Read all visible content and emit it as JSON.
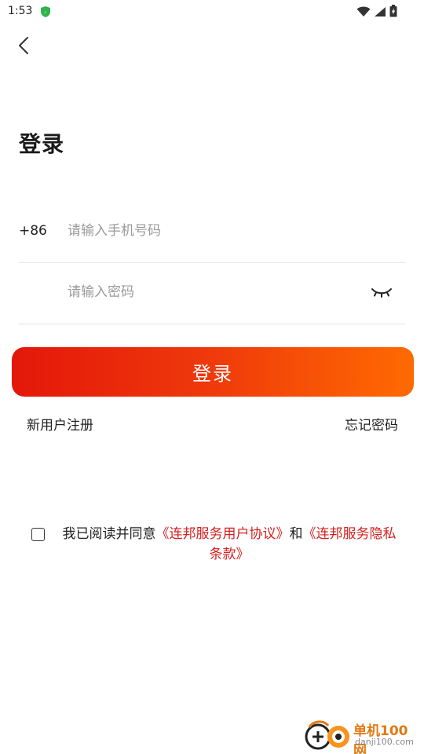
{
  "status_bar": {
    "time": "1:53",
    "shield_icon": "shield-icon",
    "wifi_icon": "wifi-icon",
    "signal_icon": "signal-icon",
    "battery_icon": "battery-charging-icon"
  },
  "header": {
    "back_icon": "chevron-left-icon",
    "title": "登录"
  },
  "form": {
    "country_code": "+86",
    "phone_placeholder": "请输入手机号码",
    "password_placeholder": "请输入密码",
    "eye_icon": "eye-closed-icon",
    "login_label": "登录"
  },
  "links": {
    "register": "新用户注册",
    "forgot": "忘记密码"
  },
  "agreement": {
    "prefix": "我已阅读并同意",
    "user_agreement": "《连邦服务用户协议》",
    "conjunction": "和",
    "privacy_policy": "《连邦服务隐私条款》"
  },
  "watermark": {
    "name": "单机100网",
    "domain": "danji100.com"
  },
  "colors": {
    "accent_start": "#e3170a",
    "accent_end": "#ff6a00",
    "link_red": "#d42020"
  }
}
